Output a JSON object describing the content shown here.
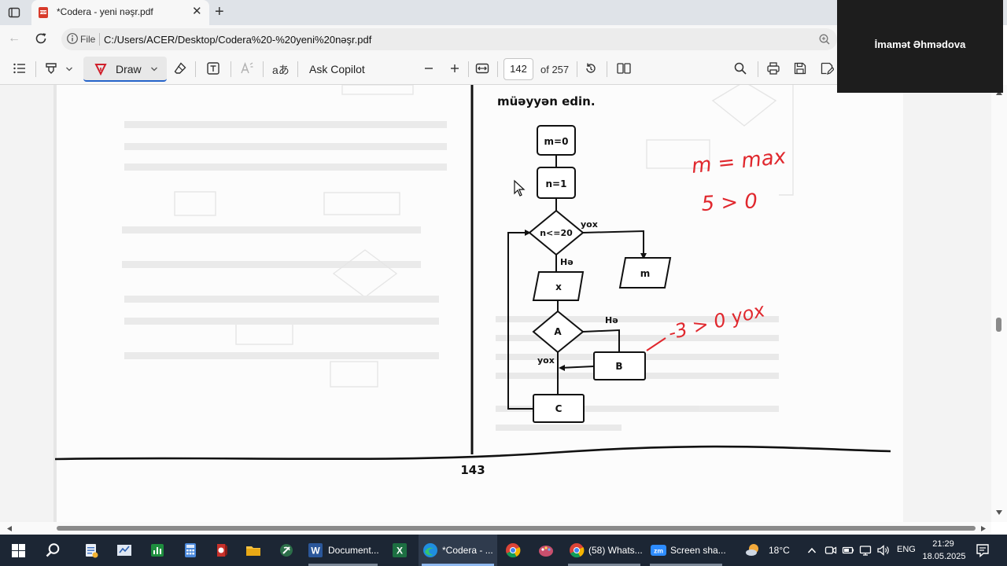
{
  "browser": {
    "tab_title": "*Codera - yeni nəşr.pdf",
    "file_label": "File",
    "url": "C:/Users/ACER/Desktop/Codera%20-%20yeni%20nəşr.pdf"
  },
  "toolbar": {
    "draw_label": "Draw",
    "text_style_label": "aあ",
    "ask_copilot_label": "Ask Copilot",
    "page_number": "142",
    "page_total": "of 257"
  },
  "profile": {
    "name": "İmamət Əhmədova"
  },
  "document": {
    "page_number": "143",
    "instruction_tail": "müəyyən edin.",
    "flowchart": {
      "nodes": {
        "init_m": "m=0",
        "init_n": "n=1",
        "loop_condition": "n<=20",
        "input": "x",
        "condition": "A",
        "action_b": "B",
        "action_c": "C",
        "output": "m"
      },
      "edge_labels": {
        "loop_no": "yox",
        "loop_yes": "Hə",
        "cond_yes": "Hə",
        "cond_no": "yox"
      }
    },
    "handwriting": {
      "line1": "m = max",
      "line2": "5 > 0",
      "line3": "-3 > 0 yox",
      "ink_color": "#e0282e"
    }
  },
  "taskbar": {
    "items": [
      {
        "icon": "start-icon"
      },
      {
        "icon": "search-icon"
      },
      {
        "icon": "notepad-icon"
      },
      {
        "icon": "whiteboard-icon"
      },
      {
        "icon": "stocks-icon"
      },
      {
        "icon": "calculator-icon"
      },
      {
        "icon": "media-icon"
      },
      {
        "icon": "file-explorer-icon"
      },
      {
        "icon": "chat-icon"
      },
      {
        "icon": "word-icon",
        "label": "Document..."
      },
      {
        "icon": "excel-icon"
      },
      {
        "icon": "edge-icon",
        "label": "*Codera - ..."
      },
      {
        "icon": "chrome-icon"
      },
      {
        "icon": "paint-icon"
      },
      {
        "icon": "chrome-icon",
        "label": "(58) Whats..."
      },
      {
        "icon": "zoom-icon",
        "label": "Screen sha..."
      }
    ],
    "weather_temp": "18°C",
    "language": "ENG",
    "time": "21:29",
    "date": "18.05.2025"
  },
  "colors": {
    "accent": "#2563c9",
    "taskbar": "#1c2634",
    "ink": "#e0282e"
  }
}
